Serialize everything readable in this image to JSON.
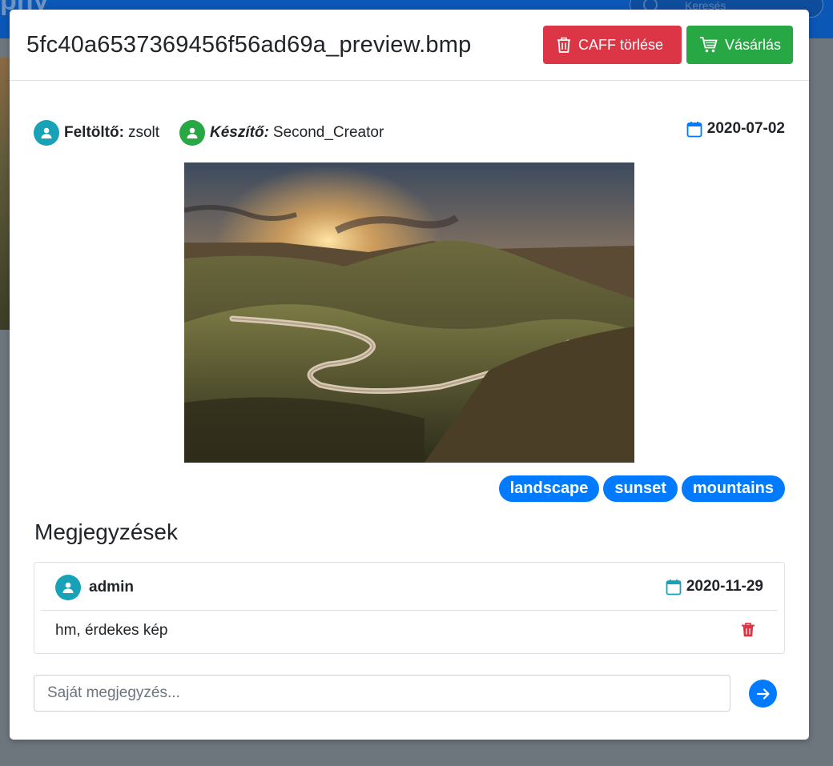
{
  "background": {
    "brand": "phy",
    "search_placeholder": "Keresés"
  },
  "modal": {
    "title": "5fc40a6537369456f56ad69a_preview.bmp",
    "delete_button": "CAFF törlése",
    "buy_button": "Vásárlás",
    "uploader_label": "Feltöltő:",
    "uploader": "zsolt",
    "creator_label": "Készítő:",
    "creator": "Second_Creator",
    "date": "2020-07-02",
    "tags": [
      "landscape",
      "sunset",
      "mountains"
    ],
    "comments_title": "Megjegyzések",
    "comments": [
      {
        "user": "admin",
        "date": "2020-11-29",
        "text": "hm, érdekes kép"
      }
    ],
    "comment_placeholder": "Saját megjegyzés..."
  },
  "colors": {
    "danger": "#dc3545",
    "success": "#28a745",
    "primary": "#007bff",
    "info": "#17a2b8",
    "navbar": "#0b57b5",
    "backdrop": "#6d757d"
  }
}
